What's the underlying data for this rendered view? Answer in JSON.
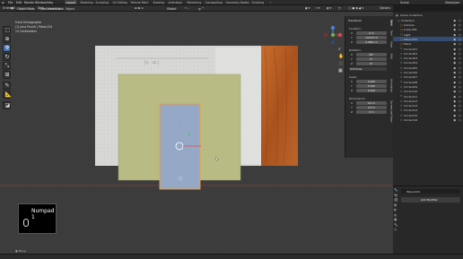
{
  "topbar": {
    "menus": [
      "File",
      "Edit",
      "Render",
      "Window",
      "Help"
    ],
    "tabs": [
      "Layout",
      "Modeling",
      "Sculpting",
      "UV Editing",
      "Texture Paint",
      "Shading",
      "Animation",
      "Rendering",
      "Compositing",
      "Geometry Nodes",
      "Scripting"
    ],
    "active_tab": "Layout",
    "scene_label": "Scene",
    "view_layer_label": "ViewLayer"
  },
  "header": {
    "mode": "Object Mode",
    "view": "View",
    "select": "Select",
    "add": "Add",
    "object": "Object",
    "orientation_label": "Orientation:",
    "orientation_value": "Default",
    "drag_label": "Drag:",
    "drag_value": "Select Box",
    "transform_pivot": "Global",
    "options": "Options"
  },
  "viewport": {
    "info_line1": "Front Orthographic",
    "info_line2": "(1) Juno Ficuslt | Plane.024",
    "info_line3": "10 Centimeters",
    "key_overlay": "Numpad 1",
    "navigate_label": "Move"
  },
  "npanel": {
    "section": "Transform",
    "location_label": "Location:",
    "loc_x": "0 m",
    "loc_y": "-0.0372 m",
    "loc_z": "0.0691 m",
    "rotation_label": "Rotation:",
    "rot_x": "90°",
    "rot_y": "0°",
    "rot_z": "0°",
    "rot_mode": "XYZ Euler",
    "scale_label": "Scale:",
    "scale_x": "0.100",
    "scale_y": "0.100",
    "scale_z": "0.100",
    "dim_label": "Dimensions:",
    "dim_x": "0.2 m",
    "dim_y": "0.4 m",
    "dim_z": "0 m",
    "tabs": [
      "Item",
      "Tool",
      "View",
      "Edit",
      "Animation",
      "Screencast Keys"
    ]
  },
  "outliner": {
    "title": "Scene Collection",
    "items": [
      {
        "label": "Collection",
        "indent": 1,
        "selected": false
      },
      {
        "label": "Camera",
        "indent": 2,
        "selected": false
      },
      {
        "label": "Cube.003",
        "indent": 2,
        "selected": false
      },
      {
        "label": "Light",
        "indent": 2,
        "selected": false
      },
      {
        "label": "Plane.024",
        "indent": 2,
        "selected": true
      },
      {
        "label": "Plane",
        "indent": 2,
        "selected": false
      },
      {
        "label": "Circle.001",
        "indent": 2,
        "selected": false
      },
      {
        "label": "Circle.002",
        "indent": 2,
        "selected": false
      },
      {
        "label": "Circle.003",
        "indent": 2,
        "selected": false
      },
      {
        "label": "Circle.004",
        "indent": 2,
        "selected": false
      },
      {
        "label": "Circle.005",
        "indent": 2,
        "selected": false
      },
      {
        "label": "Circle.006",
        "indent": 2,
        "selected": false
      },
      {
        "label": "Circle.007",
        "indent": 2,
        "selected": false
      },
      {
        "label": "Circle.008",
        "indent": 2,
        "selected": false
      },
      {
        "label": "Circle.009",
        "indent": 2,
        "selected": false
      },
      {
        "label": "Circle.010",
        "indent": 2,
        "selected": false
      },
      {
        "label": "Circle.011",
        "indent": 2,
        "selected": false
      },
      {
        "label": "Circle.012",
        "indent": 2,
        "selected": false
      },
      {
        "label": "Circle.013",
        "indent": 2,
        "selected": false
      },
      {
        "label": "Circle.014",
        "indent": 2,
        "selected": false
      },
      {
        "label": "Circle.015",
        "indent": 2,
        "selected": false
      },
      {
        "label": "Circle.016",
        "indent": 2,
        "selected": false
      }
    ]
  },
  "properties": {
    "object_name": "Plane.024",
    "add_modifier": "Add Modifier"
  },
  "colors": {
    "accent": "#4772b3",
    "selected_orange": "#ff9b2f",
    "outliner_selected": "#334c70"
  }
}
